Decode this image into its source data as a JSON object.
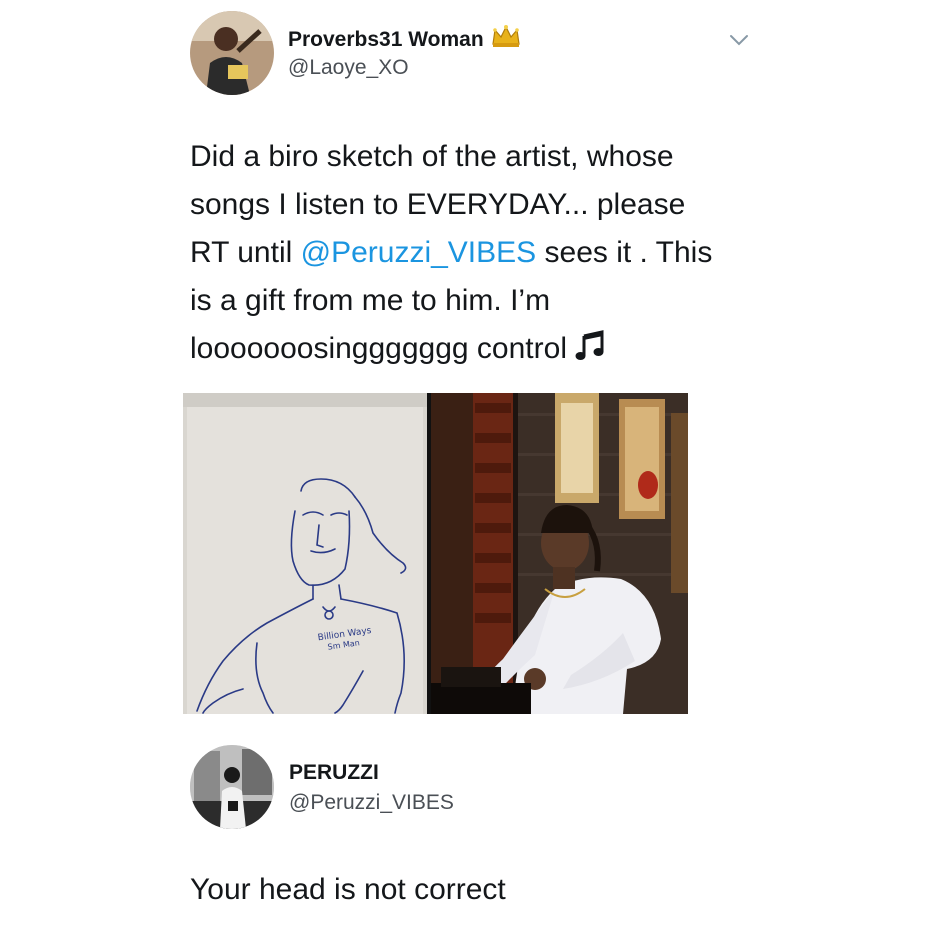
{
  "tweet": {
    "author": {
      "display_name": "Proverbs31 Woman",
      "badge": "crown-icon",
      "handle": "@Laoye_XO"
    },
    "text": {
      "line1": "Did a biro sketch of the artist, whose",
      "line2": "songs I listen to EVERYDAY... please",
      "line3_before": "RT until ",
      "line3_mention": "@Peruzzi_VIBES",
      "line3_after": " sees it . This",
      "line4": "is a gift from me to him. I’m",
      "line5": "looooooosinggggggg control "
    },
    "media": {
      "sketch_caption": "Billion Ways",
      "sketch_subcaption": "Sm Man"
    }
  },
  "reply": {
    "author": {
      "display_name": "PERUZZI",
      "handle": "@Peruzzi_VIBES"
    },
    "text": "Your head is not correct"
  },
  "colors": {
    "mention": "#1b95e0",
    "text": "#14171a",
    "secondary": "#4a4f55",
    "crown": "#e8b21b"
  }
}
